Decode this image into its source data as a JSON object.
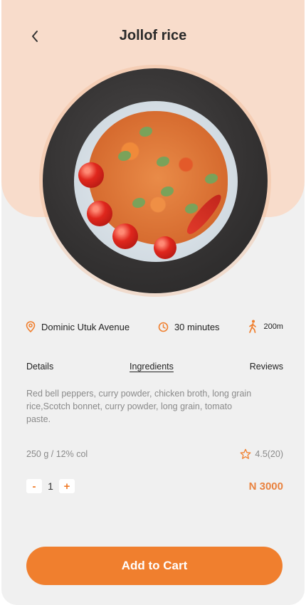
{
  "header": {
    "title": "Jollof rice",
    "back_icon": "chevron-left-icon"
  },
  "dish_image": {
    "alt": "Jollof rice"
  },
  "info": {
    "location": {
      "icon": "location-pin-icon",
      "text": "Dominic Utuk Avenue"
    },
    "time": {
      "icon": "clock-icon",
      "text": "30 minutes"
    },
    "distance": {
      "icon": "walking-person-icon",
      "text": "200m"
    }
  },
  "tabs": [
    {
      "label": "Details",
      "active": false
    },
    {
      "label": "Ingredients",
      "active": true
    },
    {
      "label": "Reviews",
      "active": false
    }
  ],
  "description": "Red bell peppers, curry powder, chicken broth, long grain rice,Scotch bonnet, curry powder, long grain, tomato paste.",
  "nutrition": "250 g / 12% col",
  "rating": {
    "icon": "star-icon",
    "text": "4.5(20)"
  },
  "quantity": {
    "minus_label": "-",
    "value": "1",
    "plus_label": "+"
  },
  "price": "N 3000",
  "cart_button": "Add to Cart",
  "colors": {
    "accent": "#f07f2e",
    "hero_background": "#f8dccb",
    "screen_background": "#f0f0f0"
  }
}
